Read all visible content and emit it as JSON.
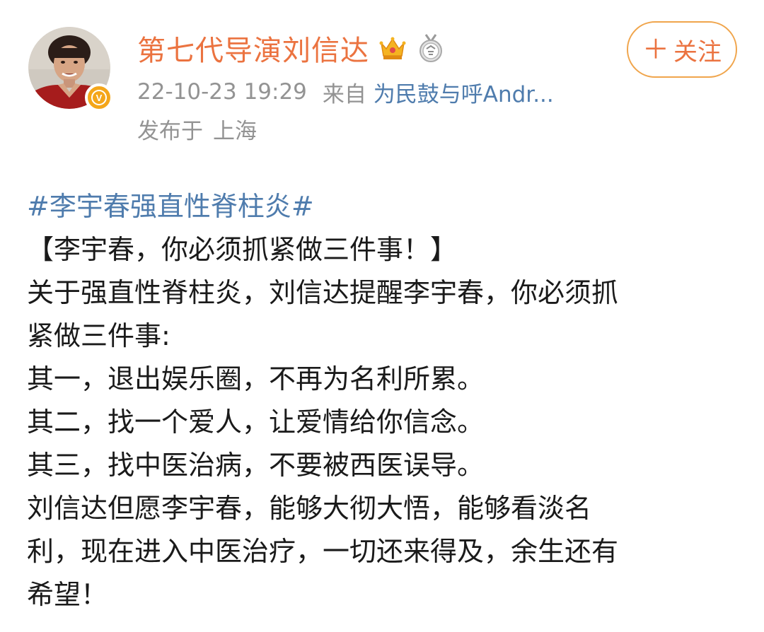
{
  "header": {
    "user_name": "第七代导演刘信达",
    "icons": [
      "crown-icon",
      "medal-icon",
      "verified-badge-icon"
    ],
    "timestamp": "22-10-23 19:29",
    "source_prefix": "来自",
    "source_name": "为民鼓与呼Andr...",
    "location_prefix": "发布于",
    "location": "上海",
    "follow_icon": "＋",
    "follow_label": "关注",
    "verified_mark": "V"
  },
  "colors": {
    "name": "#eb7340",
    "link": "#4f7cad",
    "meta": "#939393",
    "follow_border": "#f0a54c",
    "badge": "#f4a61a",
    "text": "#1a1a1a"
  },
  "post": {
    "hashtag": "#李宇春强直性脊柱炎#",
    "lines": [
      "【李宇春，你必须抓紧做三件事！】",
      "关于强直性脊柱炎，刘信达提醒李宇春，你必须抓",
      "紧做三件事:",
      "其一，退出娱乐圈，不再为名利所累。",
      "其二，找一个爱人，让爱情给你信念。",
      "其三，找中医治病，不要被西医误导。",
      "刘信达但愿李宇春，能够大彻大悟，能够看淡名",
      "利，现在进入中医治疗，一切还来得及，余生还有",
      "希望！"
    ]
  }
}
